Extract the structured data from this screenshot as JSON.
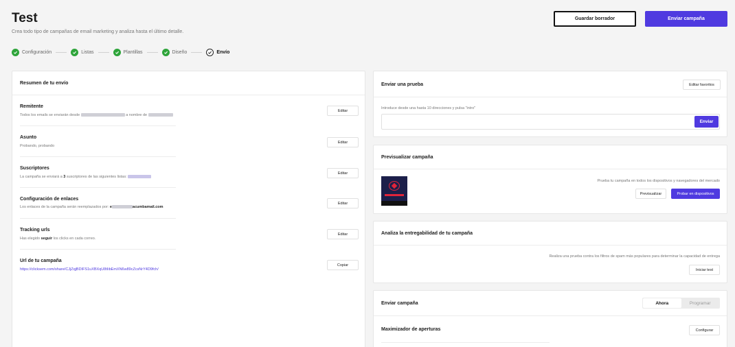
{
  "header": {
    "title": "Test",
    "subtitle": "Crea todo tipo de campañas de email marketing y analiza hasta el último detalle.",
    "draft_label": "Guardar borrador",
    "send_label": "Enviar campaña"
  },
  "steps": [
    {
      "label": "Configuración",
      "done": true
    },
    {
      "label": "Listas",
      "done": true
    },
    {
      "label": "Plantillas",
      "done": true
    },
    {
      "label": "Diseño",
      "done": true
    },
    {
      "label": "Envío",
      "done": false,
      "active": true
    }
  ],
  "summary": {
    "title": "Resumen de tu envío",
    "sender": {
      "title": "Remitente",
      "desc_pre": "Todos los emails se enviarán desde",
      "desc_mid": "a nombre de",
      "button": "Editar"
    },
    "subject": {
      "title": "Asunto",
      "desc": "Probando, probando",
      "button": "Editar"
    },
    "subscribers": {
      "title": "Suscriptores",
      "desc_pre": "La campaña se enviará a",
      "count": "3",
      "desc_post": "suscriptores de las siguientes listas:",
      "button": "Editar"
    },
    "links": {
      "title": "Configuración de enlaces",
      "desc_pre": "Los enlaces de la campaña serán reemplazados por:",
      "domain_prefix": "e",
      "domain_suffix": "acumbamail.com",
      "button": "Editar"
    },
    "tracking": {
      "title": "Tracking urls",
      "desc_pre": "Has elegido",
      "desc_bold": "seguir",
      "desc_post": "los clicks en cada correo.",
      "button": "Editar"
    },
    "campaign_url": {
      "title": "Url de tu campaña",
      "url": "https://clicksem.com/share/CJjZqjBDIFS1uXBXqU8tIibEmXN6w89cZcsNrY4D9fch/",
      "button": "Copiar"
    }
  },
  "test_send": {
    "title": "Enviar una prueba",
    "favorites_button": "Editar favoritos",
    "hint": "Introduce desde una hasta 10 direcciones y pulsa \"intro\"",
    "send_button": "Enviar"
  },
  "preview": {
    "title": "Previsualizar campaña",
    "desc": "Prueba tu campaña en todos los dispositivos y navegadores del mercado",
    "preview_button": "Previsualizar",
    "devices_button": "Probar en dispositivos"
  },
  "deliverability": {
    "title": "Analiza la entregabilidad de tu campaña",
    "desc": "Realiza una prueba contra los filtros de spam más populares para determinar la capacidad de entrega",
    "start_button": "Iniciar test"
  },
  "send_campaign": {
    "title": "Enviar campaña",
    "now_label": "Ahora",
    "schedule_label": "Programar",
    "selected": "Ahora",
    "maximizer_title": "Maximizador de aperturas",
    "configure_button": "Configurar"
  },
  "colors": {
    "accent": "#4f3ae0",
    "success": "#2ea43a"
  }
}
